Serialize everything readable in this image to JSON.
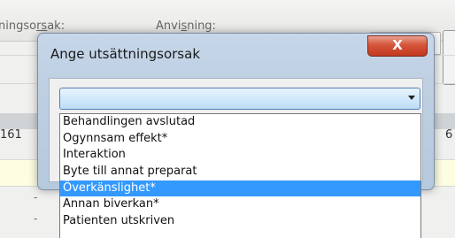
{
  "background": {
    "column_cause_label_prefix": "ningso",
    "column_cause_label_underlined": "rs",
    "column_cause_label_suffix": "ak:",
    "column_instruction_label_prefix": "Anvi",
    "column_instruction_label_underlined": "s",
    "column_instruction_label_suffix": "ning:",
    "row_left_value": "161",
    "row_right_value": "6",
    "dash_1": "-",
    "dash_2": "-"
  },
  "dialog": {
    "title": "Ange utsättningsorsak",
    "close_label": "X",
    "combo": {
      "value": ""
    },
    "options": [
      "Behandlingen avslutad",
      "Ogynnsam effekt*",
      "Interaktion",
      "Byte till annat preparat",
      "Överkänslighet*",
      "Annan biverkan*",
      "Patienten utskriven"
    ],
    "selected_index": 4
  },
  "colors": {
    "selection": "#3399ff",
    "close_button": "#c8452b",
    "dialog_frame": "#bfd0e3"
  }
}
